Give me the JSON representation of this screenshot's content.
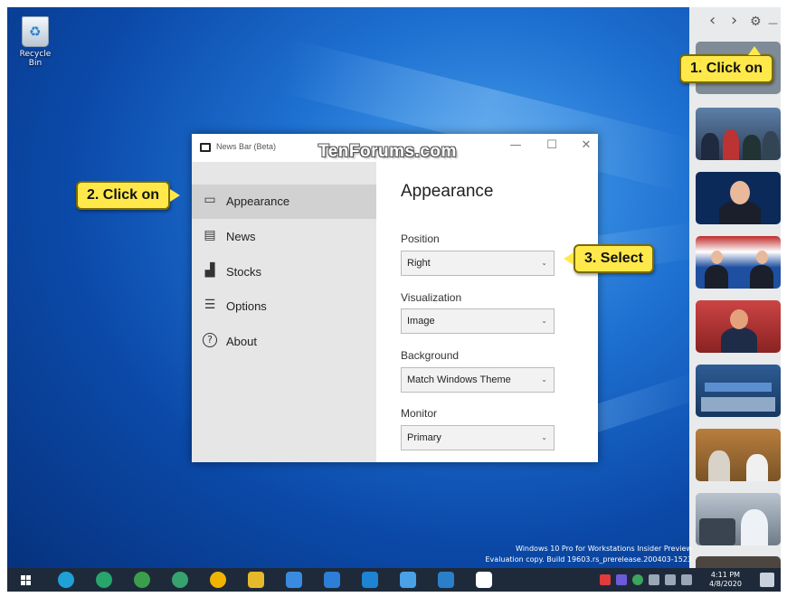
{
  "desktop": {
    "recycle_bin_label": "Recycle Bin",
    "build_line1": "Windows 10 Pro for Workstations Insider Preview",
    "build_line2": "Evaluation copy. Build 19603.rs_prerelease.200403-1523"
  },
  "window": {
    "title": "News Bar (Beta)",
    "watermark": "TenForums.com",
    "minimize_icon": "—",
    "maximize_icon": "☐",
    "close_icon": "✕"
  },
  "nav": {
    "items": [
      {
        "label": "Appearance",
        "icon": "monitor-icon",
        "glyph": "▭",
        "selected": true
      },
      {
        "label": "News",
        "icon": "newspaper-icon",
        "glyph": "▤",
        "selected": false
      },
      {
        "label": "Stocks",
        "icon": "stocks-chart-icon",
        "glyph": "▟",
        "selected": false
      },
      {
        "label": "Options",
        "icon": "sliders-icon",
        "glyph": "☰",
        "selected": false
      },
      {
        "label": "About",
        "icon": "question-icon",
        "glyph": "?",
        "selected": false
      }
    ]
  },
  "content": {
    "title": "Appearance",
    "fields": [
      {
        "label": "Position",
        "value": "Right"
      },
      {
        "label": "Visualization",
        "value": "Image"
      },
      {
        "label": "Background",
        "value": "Match Windows Theme"
      },
      {
        "label": "Monitor",
        "value": "Primary"
      }
    ],
    "chevron": "⌄"
  },
  "news_panel": {
    "back_icon": "‹",
    "forward_icon": "›",
    "settings_icon": "⚙",
    "minimize_icon": "—"
  },
  "callouts": {
    "step1": "1. Click on",
    "step2": "2. Click on",
    "step3": "3. Select"
  },
  "taskbar": {
    "time": "4:11 PM",
    "date": "4/8/2020",
    "start_icon": "windows-start-icon"
  },
  "colors": {
    "callout": "#ffe94a",
    "nav_bg": "#e6e6e6",
    "nav_selected": "#d1d1d1",
    "taskbar": "#1e2a3a"
  }
}
